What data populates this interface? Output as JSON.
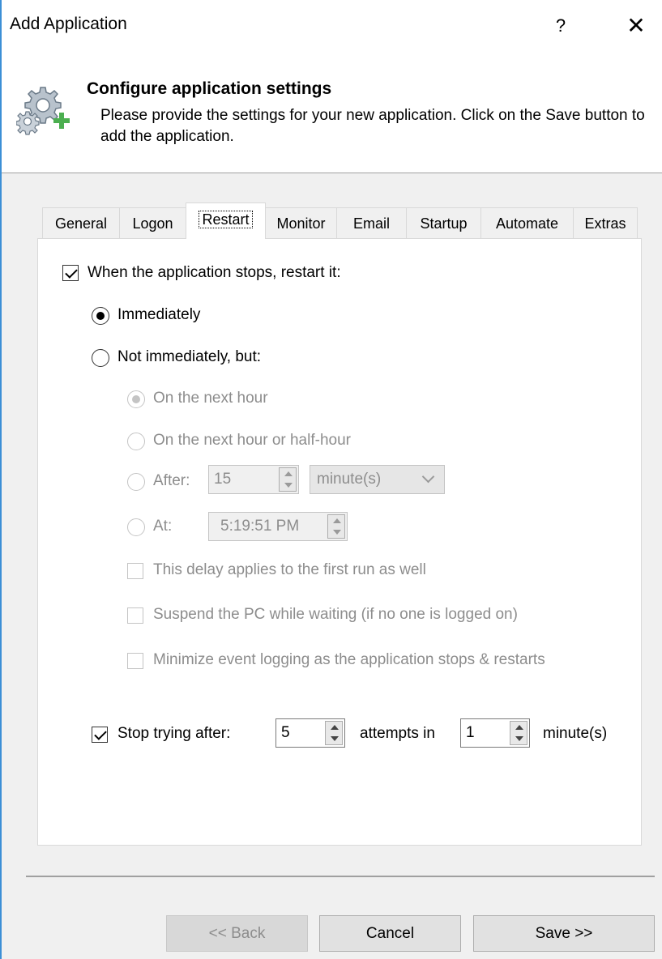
{
  "window": {
    "title": "Add Application",
    "help": "?",
    "close": "✕"
  },
  "header": {
    "title": "Configure application settings",
    "description": "Please provide the settings for your new application. Click on the Save button to add the application."
  },
  "tabs": [
    "General",
    "Logon",
    "Restart",
    "Monitor",
    "Email",
    "Startup",
    "Automate",
    "Extras"
  ],
  "active_tab": "Restart",
  "restart": {
    "restart_label": "When the application stops, restart it:",
    "restart_checked": true,
    "immediately_label": "Immediately",
    "not_immediately_label": "Not immediately, but:",
    "next_hour_label": "On the next hour",
    "next_half_hour_label": "On the next hour or half-hour",
    "after_label": "After:",
    "after_value": "15",
    "after_unit": "minute(s)",
    "at_label": "At:",
    "at_value": "5:19:51 PM",
    "first_run_label": "This delay applies to the first run as well",
    "suspend_label": "Suspend the PC while waiting (if no one is logged on)",
    "minimize_label": "Minimize event logging as the application stops & restarts",
    "stop_label": "Stop trying after:",
    "stop_checked": true,
    "attempts_value": "5",
    "attempts_in_label": "attempts in",
    "minutes_value": "1",
    "minutes_label": "minute(s)"
  },
  "buttons": {
    "back": "<< Back",
    "cancel": "Cancel",
    "save": "Save >>"
  },
  "colors": {
    "frame_accent": "#3c8fd6",
    "gear_plus": "#4caf50"
  },
  "icons": {
    "header": "gear-plus-icon"
  }
}
